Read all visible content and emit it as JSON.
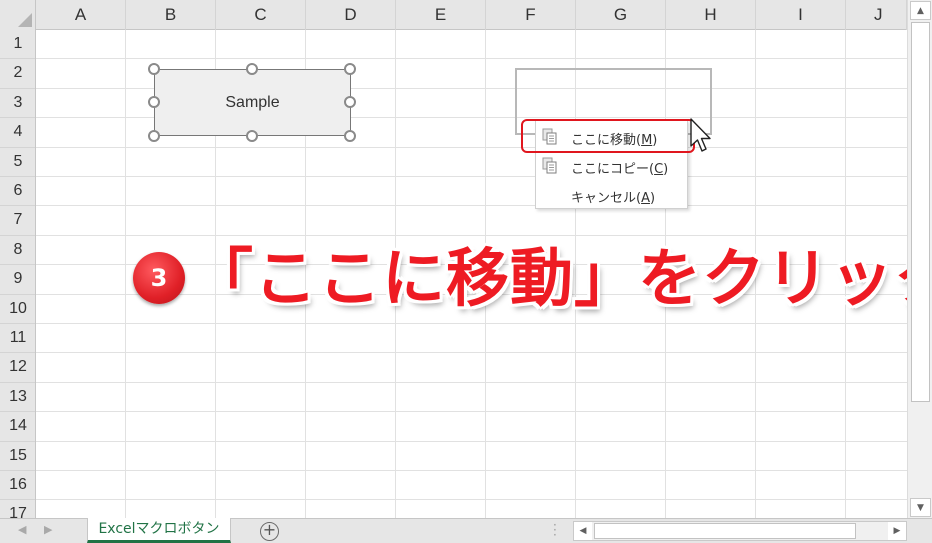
{
  "columns": [
    "A",
    "B",
    "C",
    "D",
    "E",
    "F",
    "G",
    "H",
    "I",
    "J"
  ],
  "rows": [
    "1",
    "2",
    "3",
    "4",
    "5",
    "6",
    "7",
    "8",
    "9",
    "10",
    "11",
    "12",
    "13",
    "14",
    "15",
    "16",
    "17"
  ],
  "shape": {
    "label": "Sample"
  },
  "context_menu": {
    "items": [
      {
        "label": "ここに移動(",
        "accel": "M",
        "suffix": ")",
        "icon": "paste-icon"
      },
      {
        "label": "ここにコピー(",
        "accel": "C",
        "suffix": ")",
        "icon": "paste-icon"
      },
      {
        "label": "キャンセル(",
        "accel": "A",
        "suffix": ")",
        "icon": ""
      }
    ]
  },
  "annotation": {
    "step": "3",
    "text": "「ここに移動」をクリック",
    "color": "#ee1b23"
  },
  "sheet_tabs": [
    {
      "label": "Excelマクロボタン",
      "active": true
    }
  ],
  "colors": {
    "accent": "#217346",
    "highlight": "#e0161e"
  }
}
